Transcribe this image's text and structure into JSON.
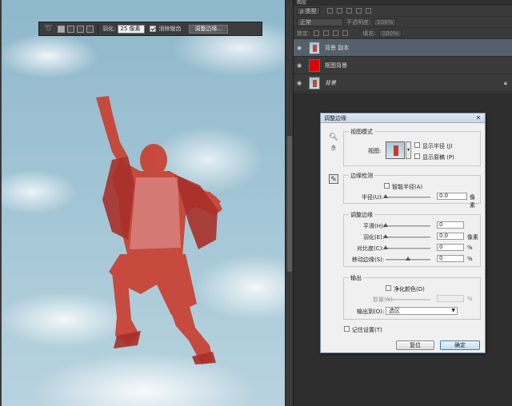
{
  "options_bar": {
    "feather_label": "羽化:",
    "feather_value": "25 像素",
    "antialias_label": "消除锯齿",
    "refine_edge_button": "调整边缘..."
  },
  "layers_panel": {
    "tab_label": "图层",
    "filter_label": "ρ 类型",
    "blend_mode": "正常",
    "opacity_label": "不透明度:",
    "opacity_value": "100%",
    "lock_label": "锁定:",
    "fill_label": "填充:",
    "fill_value": "100%",
    "layers": [
      {
        "name": "背景 副本"
      },
      {
        "name": "抠图背景"
      },
      {
        "name": "背景"
      }
    ]
  },
  "dialog": {
    "title": "调整边缘",
    "view_mode": {
      "legend": "视图模式",
      "view_label": "视图:",
      "show_radius": "显示半径 (J)",
      "show_original": "显示原稿 (P)"
    },
    "edge_detection": {
      "legend": "边缘检测",
      "smart_radius": "智能半径(A)",
      "radius_label": "半径(U):",
      "radius_value": "0.0",
      "radius_unit": "像素"
    },
    "adjust_edge": {
      "legend": "调整边缘",
      "smooth_label": "平滑(H):",
      "smooth_value": "0",
      "feather_label": "羽化(E):",
      "feather_value": "0.0",
      "feather_unit": "像素",
      "contrast_label": "对比度(C):",
      "contrast_value": "0",
      "contrast_unit": "%",
      "shift_label": "移动边缘(S):",
      "shift_value": "0",
      "shift_unit": "%"
    },
    "output": {
      "legend": "输出",
      "decontaminate": "净化颜色(D)",
      "amount_label": "数量(N):",
      "amount_unit": "%",
      "output_to_label": "输出到(O):",
      "output_to_value": "选区"
    },
    "remember": "记住设置(T)",
    "cancel": "复位",
    "ok": "确定"
  }
}
